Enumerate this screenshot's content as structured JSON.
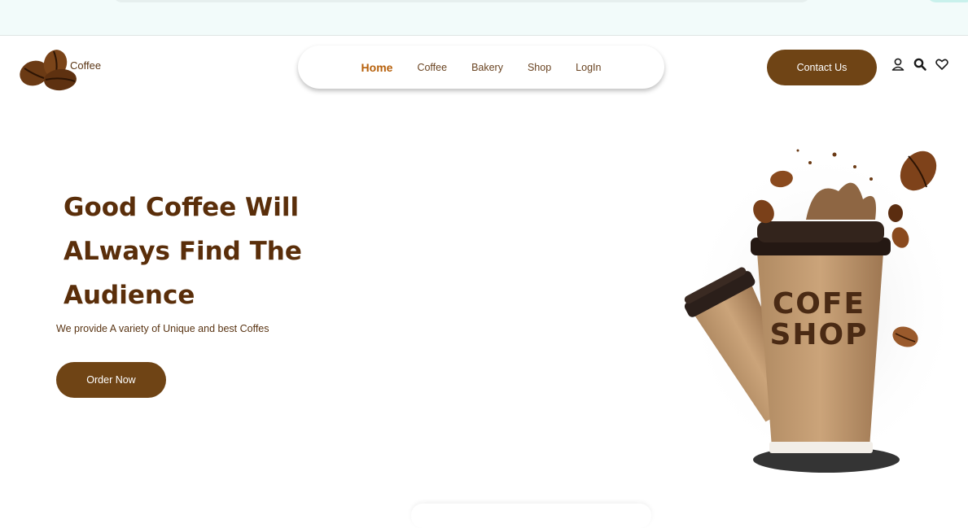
{
  "brand": {
    "name": "Coffee"
  },
  "nav": {
    "items": [
      {
        "label": "Home",
        "active": true
      },
      {
        "label": "Coffee",
        "active": false
      },
      {
        "label": "Bakery",
        "active": false
      },
      {
        "label": "Shop",
        "active": false
      },
      {
        "label": "LogIn",
        "active": false
      }
    ]
  },
  "header": {
    "contact_label": "Contact Us",
    "icons": [
      "user-icon",
      "search-icon",
      "heart-icon"
    ]
  },
  "hero": {
    "title_lines": [
      "Good Coffee Will",
      "ALways Find The",
      "Audience"
    ],
    "subtitle": "We provide A variety of Unique and best Coffes",
    "cta_label": "Order Now",
    "cup_text": [
      "COFE",
      "SHOP"
    ]
  },
  "colors": {
    "brand_brown": "#6f4415",
    "title_brown": "#5a2e0a",
    "nav_active": "#b7610c",
    "top_strip": "#f2fbfa"
  }
}
